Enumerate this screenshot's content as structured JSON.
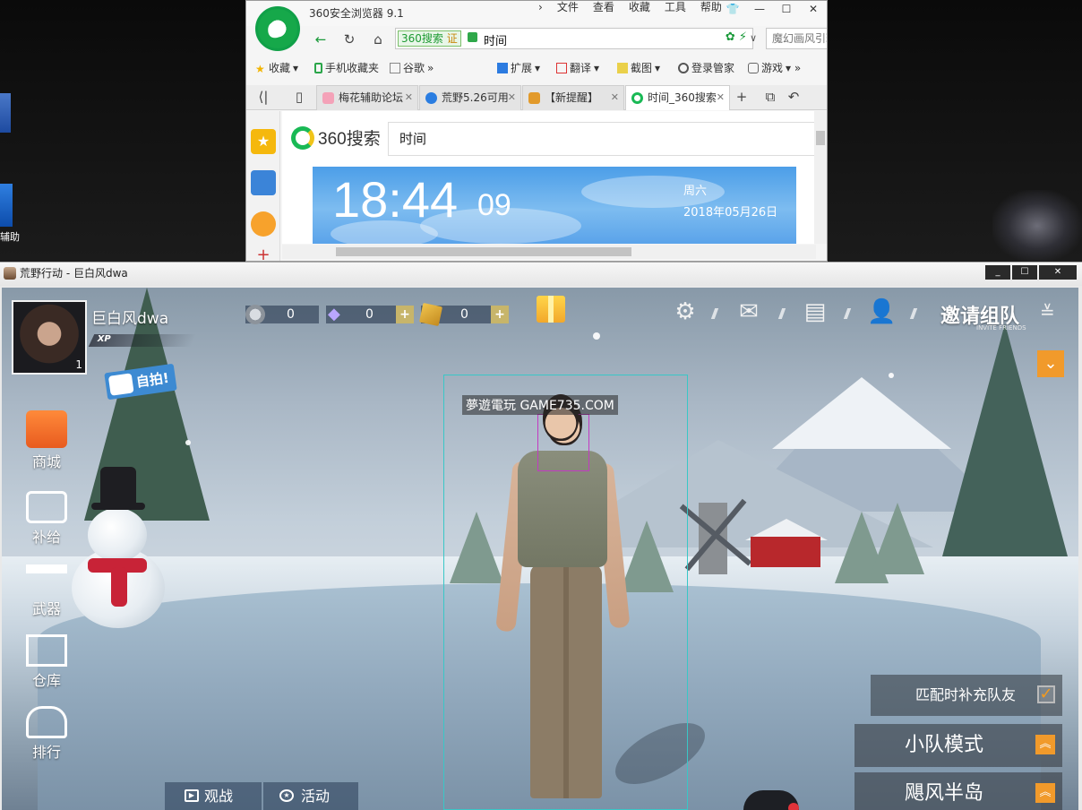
{
  "desktop": {
    "partial_icon_label": "辅助"
  },
  "browser": {
    "app_name": "360安全浏览器 9.1",
    "menu": [
      "文件",
      "查看",
      "收藏",
      "工具",
      "帮助"
    ],
    "window_buttons": [
      "👕",
      "—",
      "☐",
      "✕"
    ],
    "address": {
      "engine_tag": "360搜索",
      "verified_tag": "证",
      "url_text": "时间",
      "search_placeholder": "魔幻画风引玩家"
    },
    "bookmarks": [
      "收藏",
      "手机收藏夹",
      "谷歌",
      "扩展",
      "翻译",
      "截图",
      "登录管家",
      "游戏"
    ],
    "tabs": [
      {
        "label": "梅花辅助论坛",
        "active": false
      },
      {
        "label": "荒野5.26可用",
        "active": false
      },
      {
        "label": "【新提醒】",
        "active": false
      },
      {
        "label": "时间_360搜索",
        "active": true
      }
    ],
    "page": {
      "search_logo": "360搜索",
      "search_query": "时间",
      "clock_time": "18:44",
      "clock_seconds": "09",
      "weekday": "周六",
      "date": "2018年05月26日"
    }
  },
  "game": {
    "window_title": "荒野行动 - 巨白风dwa",
    "window_buttons": [
      "_",
      "☐",
      "✕"
    ],
    "player": {
      "name": "巨白风dwa",
      "level": "1",
      "xp_label": "XP"
    },
    "currencies": [
      {
        "name": "coin",
        "value": "0"
      },
      {
        "name": "diamond",
        "value": "0"
      },
      {
        "name": "ticket",
        "value": "0"
      }
    ],
    "selfie_label": "自拍!",
    "invite": {
      "label": "邀请组队",
      "sub": "INVITE FRIENDS"
    },
    "side_menu": [
      "商城",
      "补给",
      "武器",
      "仓库",
      "排行"
    ],
    "bottom_tabs": [
      "观战",
      "活动"
    ],
    "watermark": "夢遊電玩 GAME735.COM",
    "match_fill_label": "匹配时补充队友",
    "match_fill_checked": true,
    "mode_buttons": [
      "小队模式",
      "飓风半岛"
    ],
    "colors": {
      "accent": "#f19a2b",
      "browser_green": "#16a84a",
      "clock_blue": "#4c9ee8"
    }
  }
}
